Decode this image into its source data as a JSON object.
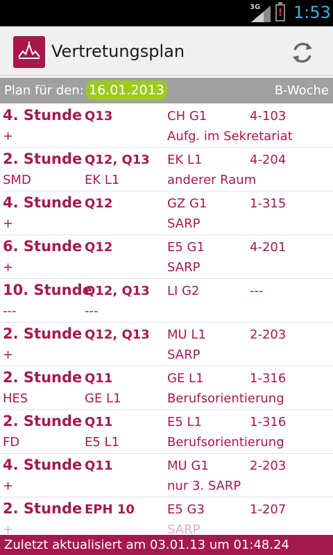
{
  "statusbar": {
    "network": "3G",
    "time": "1:53",
    "battery_alert": "!"
  },
  "appbar": {
    "title": "Vertretungsplan",
    "icons": [
      "app-logo-icon",
      "refresh-icon"
    ]
  },
  "info": {
    "label": "Plan für den:",
    "date": "16.01.2013",
    "week": "B-Woche"
  },
  "rows": [
    {
      "hour": "4. Stunde",
      "classes": "Q13",
      "subject": "CH G1",
      "room": "4-103",
      "teacher": "+",
      "subject2": "",
      "note": "Aufg. im Sekretariat"
    },
    {
      "hour": "2. Stunde",
      "classes": "Q12, Q13",
      "subject": "EK L1",
      "room": "4-204",
      "teacher": "SMD",
      "subject2": "EK L1",
      "note": "anderer Raum"
    },
    {
      "hour": "4. Stunde",
      "classes": "Q12",
      "subject": "GZ G1",
      "room": "1-315",
      "teacher": "+",
      "subject2": "",
      "note": "SARP"
    },
    {
      "hour": "6. Stunde",
      "classes": "Q12",
      "subject": "E5 G1",
      "room": "4-201",
      "teacher": "+",
      "subject2": "",
      "note": "SARP"
    },
    {
      "hour": "10. Stunde",
      "classes": "Q12, Q13",
      "subject": "LI G2",
      "room": "---",
      "teacher": "---",
      "subject2": "---",
      "note": ""
    },
    {
      "hour": "2. Stunde",
      "classes": "Q12, Q13",
      "subject": "MU L1",
      "room": "2-203",
      "teacher": "+",
      "subject2": "",
      "note": "SARP"
    },
    {
      "hour": "2. Stunde",
      "classes": "Q11",
      "subject": "GE L1",
      "room": "1-316",
      "teacher": "HES",
      "subject2": "GE L1",
      "note": "Berufsorientierung"
    },
    {
      "hour": "2. Stunde",
      "classes": "Q11",
      "subject": "E5 L1",
      "room": "1-316",
      "teacher": "FD",
      "subject2": "E5 L1",
      "note": "Berufsorientierung"
    },
    {
      "hour": "4. Stunde",
      "classes": "Q11",
      "subject": "MU G1",
      "room": "2-203",
      "teacher": "+",
      "subject2": "",
      "note": "nur 3. SARP"
    },
    {
      "hour": "2. Stunde",
      "classes": "EPH 10",
      "subject": "E5 G3",
      "room": "1-207",
      "teacher": "+",
      "subject2": "",
      "note": "SARP"
    }
  ],
  "footer": {
    "text": "Zuletzt aktualisiert am 03.01.13 um 01:48.24"
  },
  "colors": {
    "accent": "#a31a4f",
    "date_badge": "#9bca1f",
    "status_time": "#33b5e5"
  }
}
